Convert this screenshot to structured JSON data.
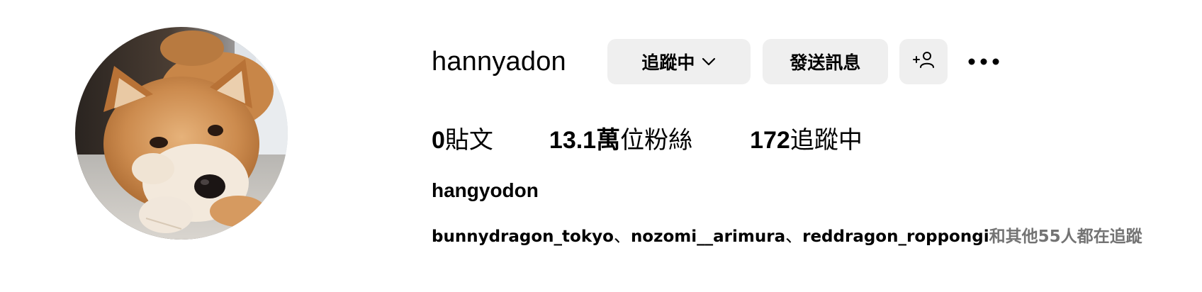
{
  "profile": {
    "username": "hannyadon",
    "full_name": "hangyodon",
    "avatar": "shiba-inu-dog-photo"
  },
  "actions": {
    "following_label": "追蹤中",
    "message_label": "發送訊息",
    "add_user_icon": "add-person-icon",
    "more_icon": "more-options-icon"
  },
  "stats": {
    "posts_count": "0",
    "posts_label": "貼文",
    "followers_count": "13.1萬",
    "followers_label": "位粉絲",
    "following_count": "172",
    "following_label": "追蹤中"
  },
  "followed_by": {
    "names": [
      "bunnydragon_tokyo",
      "nozomi__arimura",
      "reddragon_roppongi"
    ],
    "separator": "、",
    "others_text": "和其他55人都在追蹤"
  },
  "colors": {
    "button_bg": "#efefef",
    "secondary_text": "#737373"
  }
}
